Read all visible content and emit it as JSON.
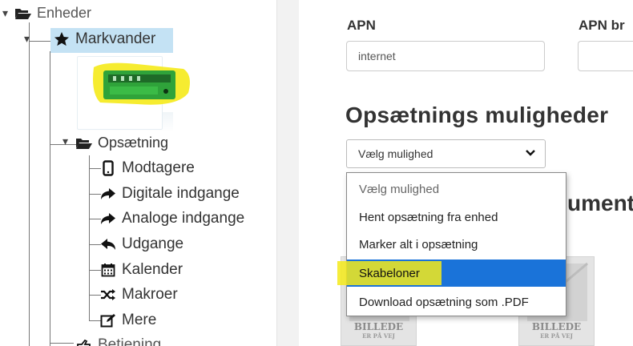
{
  "tree": {
    "root": {
      "label": "Enheder",
      "icon": "folder-open-icon"
    },
    "device": {
      "label": "Markvander",
      "icon": "star-icon"
    },
    "setup": {
      "label": "Opsætning",
      "icon": "folder-open-icon"
    },
    "children": [
      {
        "label": "Modtagere",
        "icon": "mobile-phone-icon"
      },
      {
        "label": "Digitale indgange",
        "icon": "share-arrow-icon"
      },
      {
        "label": "Analoge indgange",
        "icon": "share-arrow-icon"
      },
      {
        "label": "Udgange",
        "icon": "reply-arrow-icon"
      },
      {
        "label": "Kalender",
        "icon": "calendar-icon"
      },
      {
        "label": "Makroer",
        "icon": "shuffle-icon"
      },
      {
        "label": "Mere",
        "icon": "edit-icon"
      }
    ],
    "next": {
      "label": "Betjening",
      "icon": "hand-icon"
    }
  },
  "form": {
    "apn_label": "APN",
    "apn_value": "internet",
    "apn_user_label": "APN br"
  },
  "setup_options": {
    "title": "Opsætnings muligheder",
    "selected": "Vælg mulighed",
    "options": [
      "Vælg mulighed",
      "Hent opsætning fra enhed",
      "Marker alt i opsætning",
      "Skabeloner",
      "Download opsætning som .PDF"
    ],
    "active_option": "Skabeloner"
  },
  "documents_fragment": "ument",
  "placeholders": [
    {
      "line1": "BILLEDE",
      "line2": "ER PÅ VEJ"
    },
    {
      "line1": "BILLEDE",
      "line2": "ER PÅ VEJ"
    }
  ],
  "colors": {
    "selection": "#c4e2f4",
    "active_option": "#1a73d9",
    "highlighter": "#f5ea1a",
    "device_body": "#2fa33a"
  }
}
